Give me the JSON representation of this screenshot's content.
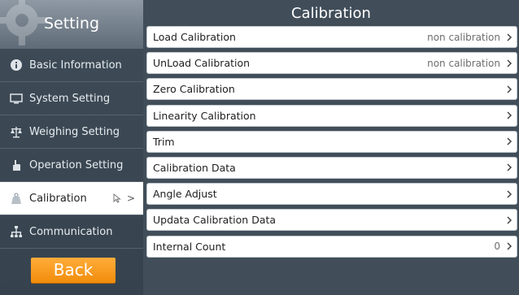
{
  "sidebar": {
    "title": "Setting",
    "items": [
      {
        "label": "Basic Information",
        "icon": "info-icon"
      },
      {
        "label": "System Setting",
        "icon": "monitor-icon"
      },
      {
        "label": "Weighing Setting",
        "icon": "scale-icon"
      },
      {
        "label": "Operation Setting",
        "icon": "hand-icon"
      },
      {
        "label": "Calibration",
        "icon": "weight-icon",
        "active": true,
        "tail_icon": "cursor-icon",
        "tail": ">"
      },
      {
        "label": "Communication",
        "icon": "network-icon"
      }
    ],
    "back_label": "Back"
  },
  "main": {
    "title": "Calibration",
    "rows": [
      {
        "label": "Load Calibration",
        "value": "non calibration"
      },
      {
        "label": "UnLoad Calibration",
        "value": "non calibration"
      },
      {
        "label": "Zero Calibration",
        "value": ""
      },
      {
        "label": "Linearity Calibration",
        "value": ""
      },
      {
        "label": "Trim",
        "value": ""
      },
      {
        "label": "Calibration Data",
        "value": ""
      },
      {
        "label": "Angle Adjust",
        "value": ""
      },
      {
        "label": "Updata Calibration Data",
        "value": ""
      },
      {
        "label": "Internal Count",
        "value": "0"
      }
    ]
  },
  "colors": {
    "sidebar_bg": "#3f4c58",
    "panel_bg": "#414e5a",
    "accent_orange": "#f5960f"
  }
}
